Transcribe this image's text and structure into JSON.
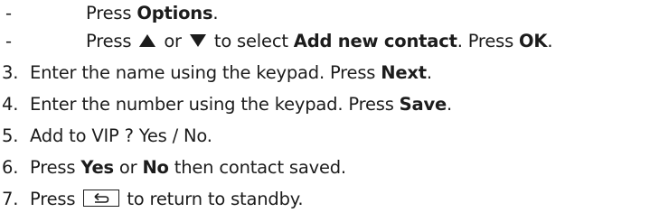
{
  "steps": [
    {
      "marker": "-",
      "parts": [
        "Press ",
        "Options",
        "."
      ]
    },
    {
      "marker": "-",
      "parts": [
        "Press ",
        " or ",
        " to select ",
        "Add new contact",
        ". Press ",
        "OK",
        "."
      ]
    },
    {
      "marker": "3.",
      "parts": [
        "Enter the name using the keypad. Press ",
        "Next",
        "."
      ]
    },
    {
      "marker": "4.",
      "parts": [
        "Enter the number using the keypad. Press ",
        "Save",
        "."
      ]
    },
    {
      "marker": "5.",
      "parts": [
        "Add to VIP ? Yes / No."
      ]
    },
    {
      "marker": "6.",
      "parts": [
        "Press ",
        "Yes",
        " or ",
        "No",
        " then contact saved."
      ]
    },
    {
      "marker": "7.",
      "parts": [
        "Press ",
        " to return to standby."
      ]
    }
  ],
  "icons": {
    "up": "up-arrow-icon",
    "down": "down-arrow-icon",
    "back": "back-key-icon"
  },
  "colors": {
    "text": "#1c1c1c"
  }
}
